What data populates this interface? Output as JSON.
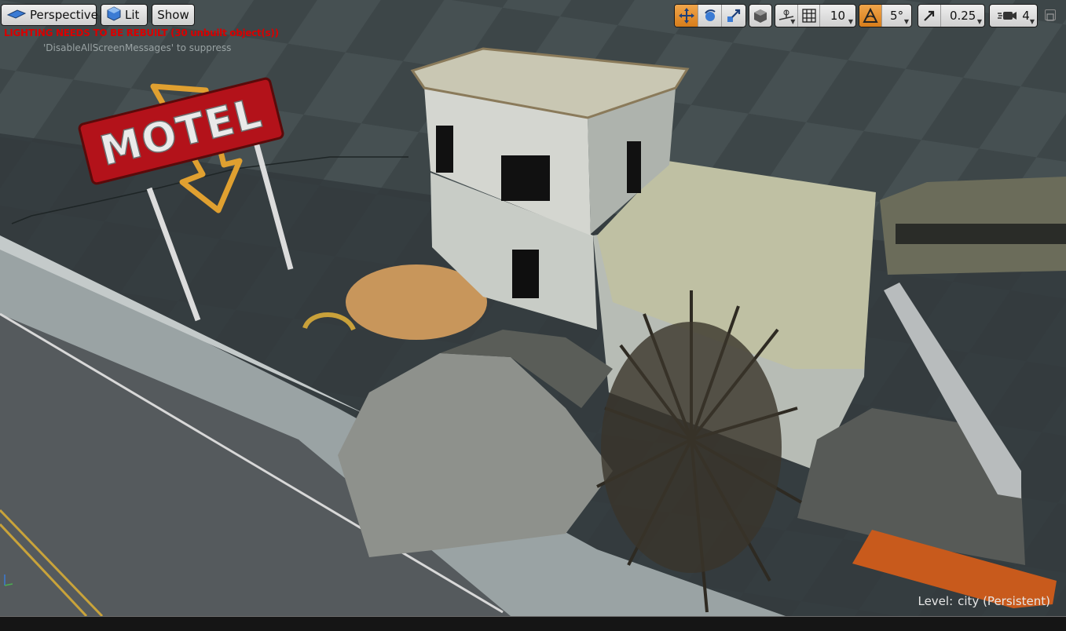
{
  "toolbar": {
    "perspective_label": "Perspective",
    "lit_label": "Lit",
    "show_label": "Show",
    "grid_snap_value": "10",
    "rotation_snap_value": "5°",
    "scale_snap_value": "0.25",
    "camera_speed_value": "4"
  },
  "messages": {
    "lighting_warning": "LIGHTING NEEDS TO BE REBUILT (30 unbuilt object(s))",
    "suppress_hint": "'DisableAllScreenMessages' to suppress"
  },
  "level": {
    "label": "Level:",
    "name": "city (Persistent)"
  },
  "scene": {
    "sign_text": "MOTEL"
  },
  "colors": {
    "accent_orange": "#e08a2a",
    "warning_red": "#d80000",
    "ground": "#3b4446",
    "sign_red": "#b3121a"
  },
  "icons": [
    "viewport-view-icon",
    "lit-cube-icon",
    "translate-icon",
    "rotate-icon",
    "scale-icon",
    "coordinate-space-icon",
    "surface-snap-icon",
    "grid-icon",
    "rotation-snap-icon",
    "scale-snap-icon",
    "camera-speed-icon",
    "maximize-icon"
  ]
}
